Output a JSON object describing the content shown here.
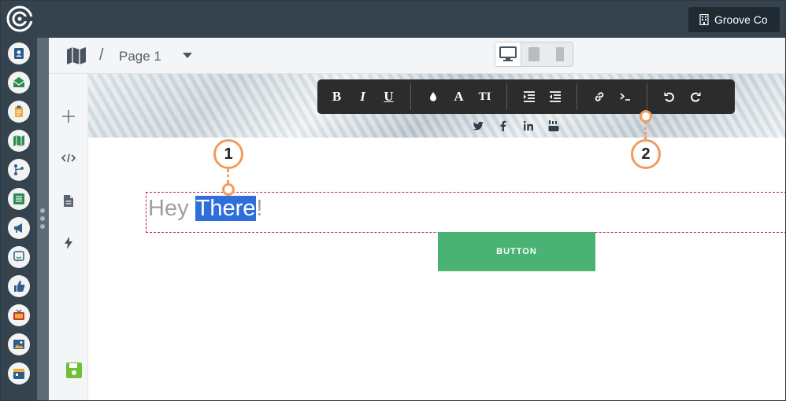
{
  "header": {
    "account_label": "Groove Co"
  },
  "breadcrumb": {
    "separator": "/",
    "page_name": "Page 1"
  },
  "canvas": {
    "text_before": "Hey ",
    "text_selected": "There",
    "text_after": "!",
    "button_label": "BUTTON"
  },
  "toolbar": {
    "bold": "B",
    "italic": "I",
    "underline": "U",
    "font": "A",
    "text_size": "TI"
  },
  "callouts": {
    "one": "1",
    "two": "2"
  },
  "icons": {
    "rail": [
      "contacts-icon",
      "mail-icon",
      "clipboard-icon",
      "map-icon",
      "flow-icon",
      "list-icon",
      "megaphone-icon",
      "chat-icon",
      "thumbs-up-icon",
      "tv-icon",
      "image-icon",
      "calendar-icon"
    ],
    "tools": [
      "plus-icon",
      "code-icon",
      "document-icon",
      "lightning-icon",
      "save-icon"
    ]
  },
  "colors": {
    "topbar": "#34434e",
    "accent_button": "#4ab374",
    "selection": "#2f6fdc",
    "callout": "#f29b5c",
    "block_outline": "#c2185b"
  }
}
